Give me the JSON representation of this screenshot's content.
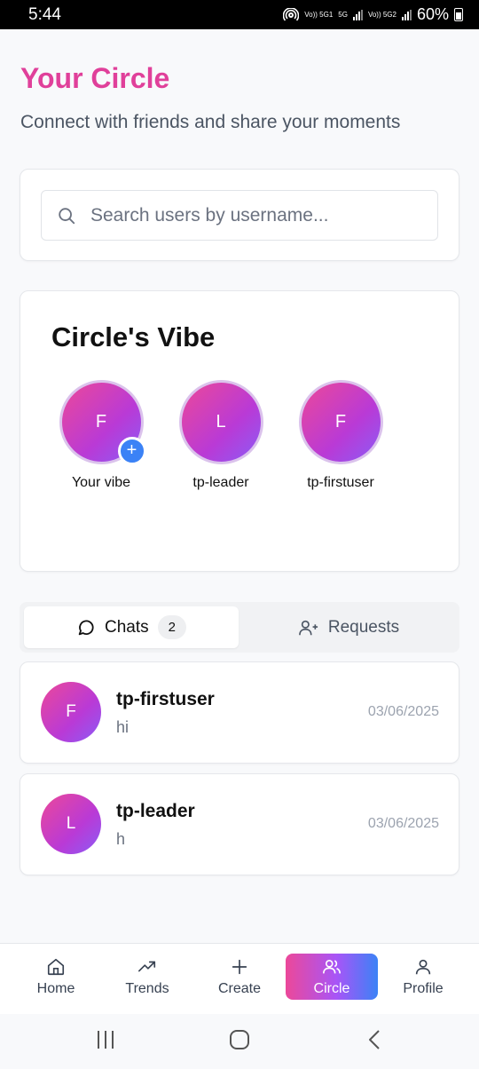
{
  "status_bar": {
    "time": "5:44",
    "network_left": "Vo)) 5G1",
    "network_5g": "5G",
    "network_right": "Vo)) 5G2",
    "battery": "60%"
  },
  "header": {
    "title": "Your Circle",
    "subtitle": "Connect with friends and share your moments"
  },
  "search": {
    "placeholder": "Search users by username..."
  },
  "vibe": {
    "title": "Circle's Vibe",
    "items": [
      {
        "initial": "F",
        "label": "Your vibe",
        "add_icon": "+"
      },
      {
        "initial": "L",
        "label": "tp-leader"
      },
      {
        "initial": "F",
        "label": "tp-firstuser"
      }
    ]
  },
  "tabs": {
    "chats_label": "Chats",
    "chats_count": "2",
    "requests_label": "Requests",
    "active": "Chats"
  },
  "chats": [
    {
      "initial": "F",
      "name": "tp-firstuser",
      "last_message": "hi",
      "date": "03/06/2025"
    },
    {
      "initial": "L",
      "name": "tp-leader",
      "last_message": "h",
      "date": "03/06/2025"
    }
  ],
  "bottom_nav": [
    {
      "label": "Home",
      "icon": "home-icon"
    },
    {
      "label": "Trends",
      "icon": "trending-up-icon"
    },
    {
      "label": "Create",
      "icon": "plus-icon"
    },
    {
      "label": "Circle",
      "icon": "users-icon",
      "active": true
    },
    {
      "label": "Profile",
      "icon": "user-icon"
    }
  ],
  "colors": {
    "accent_pink": "#e0409a",
    "gradient_start": "#ec4899",
    "gradient_mid": "#a855f7",
    "gradient_end": "#3b82f6",
    "plus_badge": "#3b82f6"
  }
}
